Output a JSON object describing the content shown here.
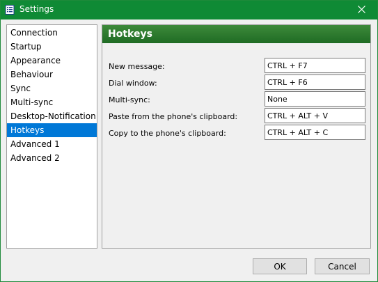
{
  "window": {
    "title": "Settings"
  },
  "sidebar": {
    "items": [
      {
        "label": "Connection",
        "selected": false
      },
      {
        "label": "Startup",
        "selected": false
      },
      {
        "label": "Appearance",
        "selected": false
      },
      {
        "label": "Behaviour",
        "selected": false
      },
      {
        "label": "Sync",
        "selected": false
      },
      {
        "label": "Multi-sync",
        "selected": false
      },
      {
        "label": "Desktop-Notification",
        "selected": false
      },
      {
        "label": "Hotkeys",
        "selected": true
      },
      {
        "label": "Advanced 1",
        "selected": false
      },
      {
        "label": "Advanced 2",
        "selected": false
      }
    ]
  },
  "panel": {
    "title": "Hotkeys",
    "rows": [
      {
        "label": "New message:",
        "value": "CTRL + F7"
      },
      {
        "label": "Dial window:",
        "value": "CTRL + F6"
      },
      {
        "label": "Multi-sync:",
        "value": "None"
      },
      {
        "label": "Paste from the phone's clipboard:",
        "value": "CTRL + ALT + V"
      },
      {
        "label": "Copy to the phone's clipboard:",
        "value": "CTRL + ALT + C"
      }
    ]
  },
  "footer": {
    "ok_label": "OK",
    "cancel_label": "Cancel"
  },
  "colors": {
    "titlebar": "#0f8a35",
    "header_gradient_top": "#3d8a3a",
    "header_gradient_bottom": "#1f6b24",
    "selection": "#0078d7"
  },
  "icons": {
    "app": "settings-app-icon",
    "close": "close-icon"
  }
}
